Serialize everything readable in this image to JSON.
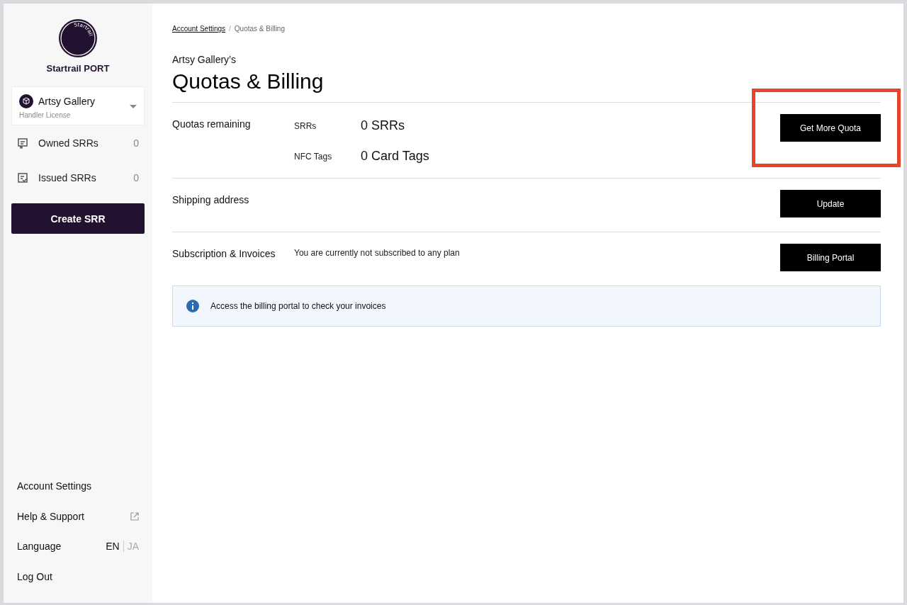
{
  "sidebar": {
    "logo_text": "Startrail",
    "brand": "Startrail PORT",
    "account": {
      "name": "Artsy Gallery",
      "license": "Handler License"
    },
    "nav": [
      {
        "kind": "owned",
        "label": "Owned SRRs",
        "count": "0"
      },
      {
        "kind": "issued",
        "label": "Issued SRRs",
        "count": "0"
      }
    ],
    "create_button": "Create SRR",
    "footer": [
      {
        "kind": "link",
        "label": "Account Settings"
      },
      {
        "kind": "external",
        "label": "Help & Support"
      },
      {
        "kind": "language",
        "label": "Language",
        "options": [
          {
            "label": "EN",
            "selected": true
          },
          {
            "label": "JA",
            "selected": false
          }
        ]
      },
      {
        "kind": "link",
        "label": "Log Out"
      }
    ]
  },
  "breadcrumb": [
    {
      "label": "Account Settings",
      "link": true
    },
    {
      "label": "Quotas & Billing",
      "link": false
    }
  ],
  "breadcrumb_separator": "/",
  "subtitle": "Artsy Gallery’s",
  "title": "Quotas & Billing",
  "sections": [
    {
      "label": "Quotas remaining",
      "rows": [
        {
          "key": "SRRs",
          "value": "0 SRRs"
        },
        {
          "key": "NFC Tags",
          "value": "0 Card Tags"
        }
      ],
      "button": "Get More Quota",
      "highlighted": true
    },
    {
      "label": "Shipping address",
      "button": "Update",
      "highlighted": false
    },
    {
      "label": "Subscription & Invoices",
      "note": "You are currently not subscribed to any plan",
      "button": "Billing Portal",
      "highlighted": false
    }
  ],
  "info": "Access the billing portal to check your invoices"
}
